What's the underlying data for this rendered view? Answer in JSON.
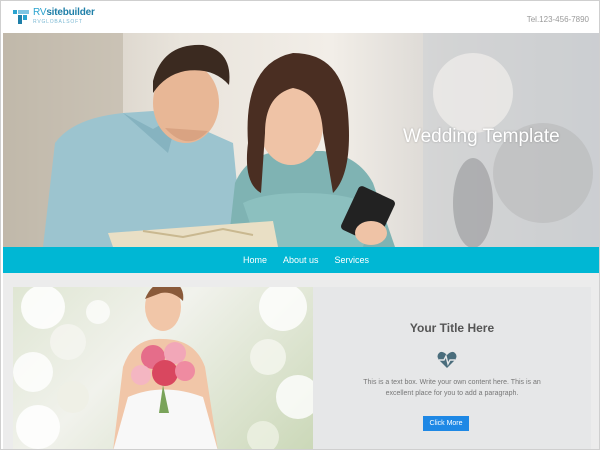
{
  "header": {
    "logo_name_light": "RV",
    "logo_name_bold": "sitebuilder",
    "logo_sub": "RVGLOBALSOFT",
    "phone": "Tel.123-456-7890"
  },
  "hero": {
    "title": "Wedding Template"
  },
  "nav": {
    "items": [
      {
        "label": "Home"
      },
      {
        "label": "About us"
      },
      {
        "label": "Services"
      }
    ]
  },
  "feature": {
    "title": "Your Title Here",
    "icon": "heartbeat-icon",
    "text": "This is a text box. Write your own content here. This is an excellent place for you to add a paragraph.",
    "button_label": "Click More"
  },
  "colors": {
    "nav_bg": "#00b7d4",
    "button_bg": "#1e88e5",
    "logo": "#2aa3cf"
  }
}
